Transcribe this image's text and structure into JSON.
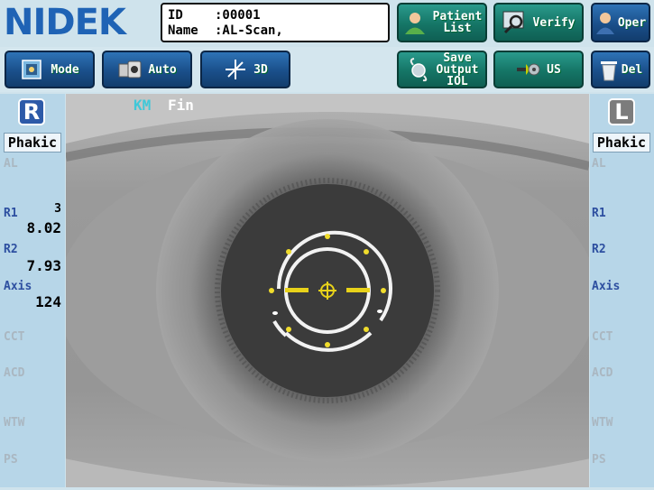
{
  "header": {
    "logo": "NIDEK",
    "patient": {
      "id_label": "ID",
      "id_value": ":00001",
      "name_label": "Name",
      "name_value": ":AL-Scan,"
    }
  },
  "toolbar_top": {
    "patient_list": {
      "line1": "Patient",
      "line2": "List",
      "icon": "patient-icon"
    },
    "verify": {
      "label": "Verify",
      "icon": "magnifier-icon"
    },
    "oper": {
      "label": "Oper",
      "icon": "operator-icon"
    }
  },
  "toolbar_second": {
    "mode": {
      "label": "Mode",
      "icon": "mode-icon"
    },
    "auto": {
      "label": "Auto",
      "icon": "camera-icon"
    },
    "view3d": {
      "label": "3D",
      "icon": "move-arrows-icon"
    },
    "save_output": {
      "line1": "Save",
      "line2": "Output",
      "line3": "IOL",
      "icon": "iol-icon"
    },
    "us": {
      "label": "US",
      "icon": "ultrasound-probe-icon"
    },
    "del": {
      "label": "Del",
      "icon": "trash-icon"
    }
  },
  "status": {
    "km": "KM",
    "fin": "Fin"
  },
  "left_panel": {
    "eye": "R",
    "lens_status": "Phakic",
    "al_label": "AL",
    "r1_label": "R1",
    "r1_count": "3",
    "r1_value": "8.02",
    "r2_label": "R2",
    "r2_value": "7.93",
    "axis_label": "Axis",
    "axis_value": "124",
    "cct_label": "CCT",
    "acd_label": "ACD",
    "wtw_label": "WTW",
    "ps_label": "PS"
  },
  "right_panel": {
    "eye": "L",
    "lens_status": "Phakic",
    "al_label": "AL",
    "r1_label": "R1",
    "r2_label": "R2",
    "axis_label": "Axis",
    "cct_label": "CCT",
    "acd_label": "ACD",
    "wtw_label": "WTW",
    "ps_label": "PS"
  },
  "colors": {
    "logo": "#1f63b5",
    "button_teal": "#157566",
    "button_blue": "#1a4f8a",
    "active_label": "#2d4fa0",
    "inactive_label": "#aab7c1",
    "km_text": "#40c8d8",
    "reticle_yellow": "#e8d21a"
  }
}
